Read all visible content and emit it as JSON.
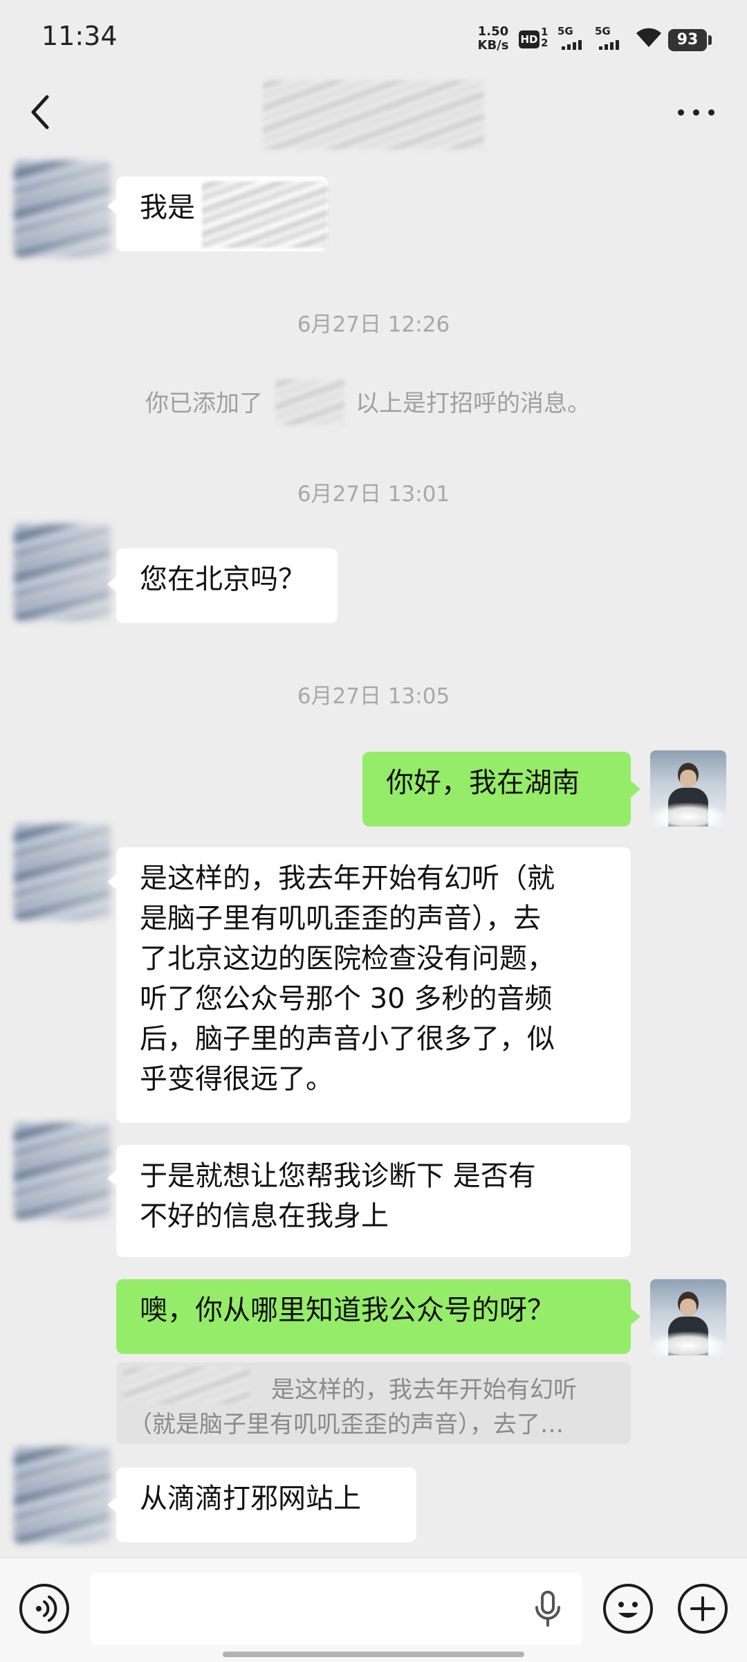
{
  "status_bar": {
    "time": "11:34",
    "net_speed_value": "1.50",
    "net_speed_unit": "KB/s",
    "hd_label": "HD",
    "hd_sub_top": "1",
    "hd_sub_bottom": "2",
    "sim1_label": "5G",
    "sim2_label": "5G",
    "battery": "93",
    "icons": [
      "hd-voice-icon",
      "signal-icon",
      "signal-icon",
      "wifi-icon",
      "battery-icon"
    ]
  },
  "header": {
    "back_icon": "chevron-left-icon",
    "more_icon": "more-dots-icon"
  },
  "messages": [
    {
      "side": "in",
      "text": "我是"
    },
    {
      "timestamp": "6月27日 12:26"
    },
    {
      "system_prefix": "你已添加了",
      "system_suffix": "以上是打招呼的消息。"
    },
    {
      "timestamp": "6月27日 13:01"
    },
    {
      "side": "in",
      "text": "您在北京吗？"
    },
    {
      "timestamp": "6月27日 13:05"
    },
    {
      "side": "out",
      "text": "你好，我在湖南"
    },
    {
      "side": "in",
      "lines": [
        "是这样的，我去年开始有幻听（就",
        "是脑子里有叽叽歪歪的声音），去",
        "了北京这边的医院检查没有问题，",
        "听了您公众号那个 30 多秒的音频",
        "后，脑子里的声音小了很多了，似",
        "乎变得很远了。"
      ]
    },
    {
      "side": "in",
      "lines": [
        "于是就想让您帮我诊断下 是否有",
        "不好的信息在我身上"
      ]
    },
    {
      "side": "out",
      "text": "噢，你从哪里知道我公众号的呀？",
      "quote_line1": "是这样的，我去年开始有幻听",
      "quote_line2": "（就是脑子里有叽叽歪歪的声音），去了…"
    },
    {
      "side": "in",
      "text": "从滴滴打邪网站上"
    }
  ],
  "input_bar": {
    "voice_icon": "voice-mode-icon",
    "mic_icon": "microphone-icon",
    "emoji_icon": "emoji-icon",
    "plus_icon": "plus-icon",
    "text_value": ""
  },
  "colors": {
    "background": "#ededed",
    "bubble_in": "#ffffff",
    "bubble_out": "#95ec69",
    "timestamp": "#a8a8a8"
  }
}
